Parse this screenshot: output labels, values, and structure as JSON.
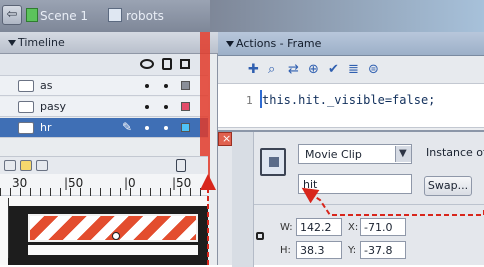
{
  "topbar": {
    "back_icon": "back-arrow-icon",
    "scene_label": "Scene 1",
    "robot_label": "robots"
  },
  "timeline": {
    "title": "Timeline",
    "layers": [
      {
        "name": "as"
      },
      {
        "name": "pasy"
      },
      {
        "name": "hr"
      }
    ],
    "ruler_labels": [
      "30",
      "|50",
      "|0",
      "|50"
    ]
  },
  "actions": {
    "title": "Actions - Frame",
    "line_number": "1",
    "code": "this.hit._visible=false;"
  },
  "properties": {
    "symbol_type": "Movie Clip",
    "instance_label": "Instance of",
    "instance_name": "hit",
    "swap_label": "Swap...",
    "w_label": "W:",
    "w_value": "142.2",
    "x_label": "X:",
    "x_value": "-71.0",
    "h_label": "H:",
    "h_value": "38.3",
    "y_label": "Y:",
    "y_value": "-37.8"
  },
  "colors": {
    "annotation_red": "#d8261c",
    "active_layer": "#3f6fb5"
  }
}
